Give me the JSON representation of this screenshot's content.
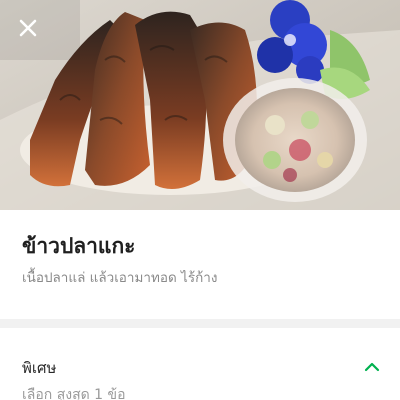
{
  "hero": {
    "image": "grilled-fish-on-rice-with-pickled-veg",
    "close_icon": "close-icon"
  },
  "item": {
    "name": "ข้าวปลาแกะ",
    "description": "เนื้อปลาแล่ แล้วเอามาทอด ไร้ก้าง"
  },
  "options": {
    "title": "พิเศษ",
    "rule": "เลือก สูงสุด 1 ข้อ",
    "expanded": true,
    "chevron_icon": "chevron-up-icon"
  },
  "colors": {
    "accent": "#00b14f",
    "title": "#1f1f1f",
    "muted": "#8a8a8a",
    "divider": "#f1f1f1"
  }
}
